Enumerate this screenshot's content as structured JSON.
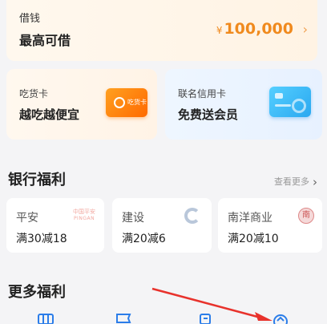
{
  "loan": {
    "label": "借钱",
    "subtitle": "最高可借",
    "currency": "¥",
    "amount": "100,000",
    "chevron": "›"
  },
  "cards": [
    {
      "title": "吃货卡",
      "subtitle": "越吃越便宜",
      "image_text": "吃货卡"
    },
    {
      "title": "联名信用卡",
      "subtitle": "免费送会员"
    }
  ],
  "bank_section": {
    "title": "银行福利",
    "more": "查看更多",
    "more_arrow": "›",
    "banks": [
      {
        "name": "平安",
        "offer": "满30减18",
        "logo_top": "中国平安",
        "logo_bottom": "PINGAN"
      },
      {
        "name": "建设",
        "offer": "满20减6"
      },
      {
        "name": "南洋商业",
        "offer": "满20减10",
        "logo_char": "南"
      }
    ]
  },
  "more_section": {
    "title": "更多福利"
  },
  "colors": {
    "accent": "#f08a1e",
    "arrow": "#e8322c"
  }
}
